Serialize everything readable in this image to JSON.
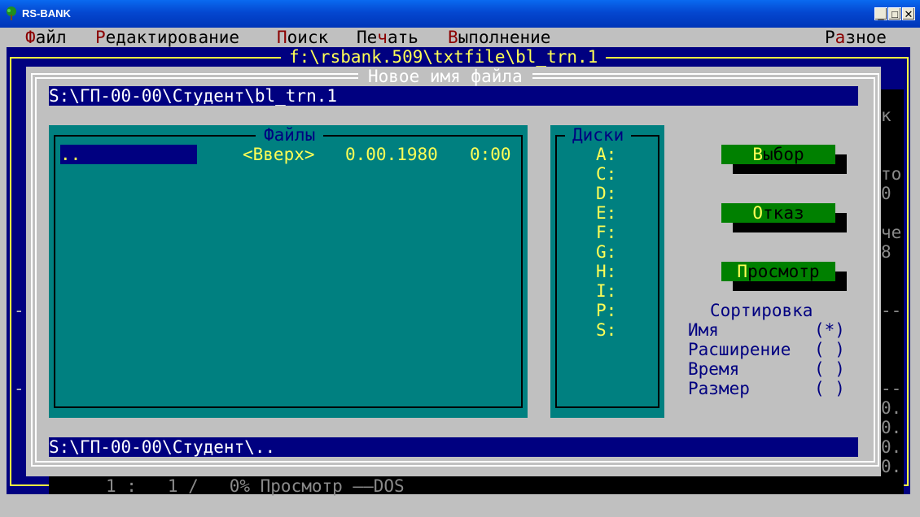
{
  "window": {
    "title": "RS-BANK"
  },
  "menu": {
    "items": [
      {
        "hot": "Ф",
        "rest": "айл"
      },
      {
        "hot": "Р",
        "rest": "едактирование"
      },
      {
        "hot": "П",
        "rest": "оиск"
      },
      {
        "pre": "Пе",
        "hot": "ч",
        "rest": "ать"
      },
      {
        "hot": "В",
        "rest": "ыполнение"
      },
      {
        "pre": "Р",
        "hot": "а",
        "rest": "зное"
      }
    ]
  },
  "editor": {
    "file_path": "f:\\rsbank.509\\txtfile\\bl_trn.1",
    "status_line": "1 :   1 /   0% Просмотр ——DOS",
    "right_fragments": [
      "к",
      "то",
      "0",
      "че",
      "8",
      "--",
      "--",
      "0.",
      "0.",
      "0.",
      "0."
    ],
    "left_fragments": [
      "-",
      "-"
    ]
  },
  "dialog": {
    "title": "Новое имя файла",
    "filename": "S:\\ГП-00-00\\Студент\\bl_trn.1",
    "current_dir": "S:\\ГП-00-00\\Студент\\..",
    "files_title": "Файлы",
    "files": [
      {
        "name": "..",
        "type": "<Вверх>",
        "date": "0.00.1980",
        "time": "0:00"
      }
    ],
    "disks_title": "Диски",
    "disks": [
      "A:",
      "C:",
      "D:",
      "E:",
      "F:",
      "G:",
      "H:",
      "I:",
      "P:",
      "S:"
    ],
    "buttons": {
      "select": {
        "hot": "В",
        "rest": "ыбор"
      },
      "cancel": {
        "hot": "О",
        "rest": "тказ"
      },
      "view": {
        "hot": "П",
        "rest": "росмотр"
      }
    },
    "sort": {
      "title": "Сортировка",
      "options": [
        {
          "label": "Имя",
          "mark": "(*)"
        },
        {
          "label": "Расширение",
          "mark": "( )"
        },
        {
          "label": "Время",
          "mark": "( )"
        },
        {
          "label": "Размер",
          "mark": "( )"
        }
      ]
    }
  },
  "colors": {
    "title_bar": "#0054e3",
    "dos_gray": "#c0c0c0",
    "navy": "#000080",
    "teal": "#008080",
    "yellow": "#ffff55",
    "green": "#008000"
  }
}
